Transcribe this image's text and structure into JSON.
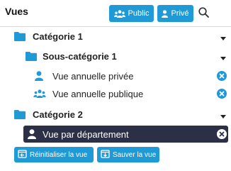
{
  "header": {
    "title": "Vues",
    "public_label": "Public",
    "prive_label": "Privé"
  },
  "tree": {
    "cat1": "Catégorie 1",
    "subcat1": "Sous-catégorie 1",
    "vue_privee": "Vue annuelle privée",
    "vue_publique": "Vue annuelle publique",
    "cat2": "Catégorie 2",
    "vue_dept": "Vue par département"
  },
  "footer": {
    "reset_label": "Réinitialiser la vue",
    "save_label": "Sauver la vue"
  },
  "colors": {
    "accent": "#1f9ad6",
    "selected_bg": "#2b3047"
  },
  "icons": {
    "folder": "folder-icon",
    "user": "user-icon",
    "users": "users-icon",
    "search": "search-icon",
    "caret": "caret-down-icon",
    "remove": "close-circle-icon",
    "reset": "reset-view-icon",
    "save": "save-view-icon"
  }
}
